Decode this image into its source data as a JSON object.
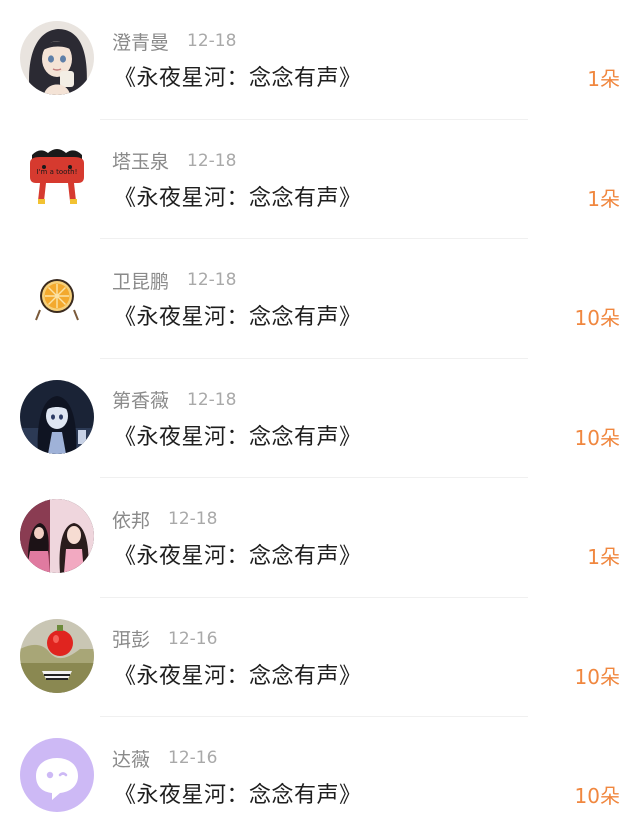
{
  "gifts": [
    {
      "name": "澄青曼",
      "date": "12-18",
      "title": "《永夜星河：念念有声》",
      "amount": "1朵",
      "avatar_icon": "girl-anime-avatar-icon"
    },
    {
      "name": "塔玉泉",
      "date": "12-18",
      "title": "《永夜星河：念念有声》",
      "amount": "1朵",
      "avatar_icon": "tooth-cartoon-avatar-icon",
      "avatar_text": "I'm a tooth!"
    },
    {
      "name": "卫昆鹏",
      "date": "12-18",
      "title": "《永夜星河：念念有声》",
      "amount": "10朵",
      "avatar_icon": "orange-slice-avatar-icon"
    },
    {
      "name": "第香薇",
      "date": "12-18",
      "title": "《永夜星河：念念有声》",
      "amount": "10朵",
      "avatar_icon": "anime-girl-night-avatar-icon"
    },
    {
      "name": "依邦",
      "date": "12-18",
      "title": "《永夜星河：念念有声》",
      "amount": "1朵",
      "avatar_icon": "pink-girl-photo-avatar-icon"
    },
    {
      "name": "弭彭",
      "date": "12-16",
      "title": "《永夜星河：念念有声》",
      "amount": "10朵",
      "avatar_icon": "red-balloon-avatar-icon"
    },
    {
      "name": "达薇",
      "date": "12-16",
      "title": "《永夜星河：念念有声》",
      "amount": "10朵",
      "avatar_icon": "chat-bubble-avatar-icon"
    }
  ],
  "colors": {
    "name": "#8a8a8a",
    "date": "#a9a9a9",
    "title": "#1e1e1e",
    "amount": "#f0873f",
    "divider": "#f0f0f0"
  }
}
